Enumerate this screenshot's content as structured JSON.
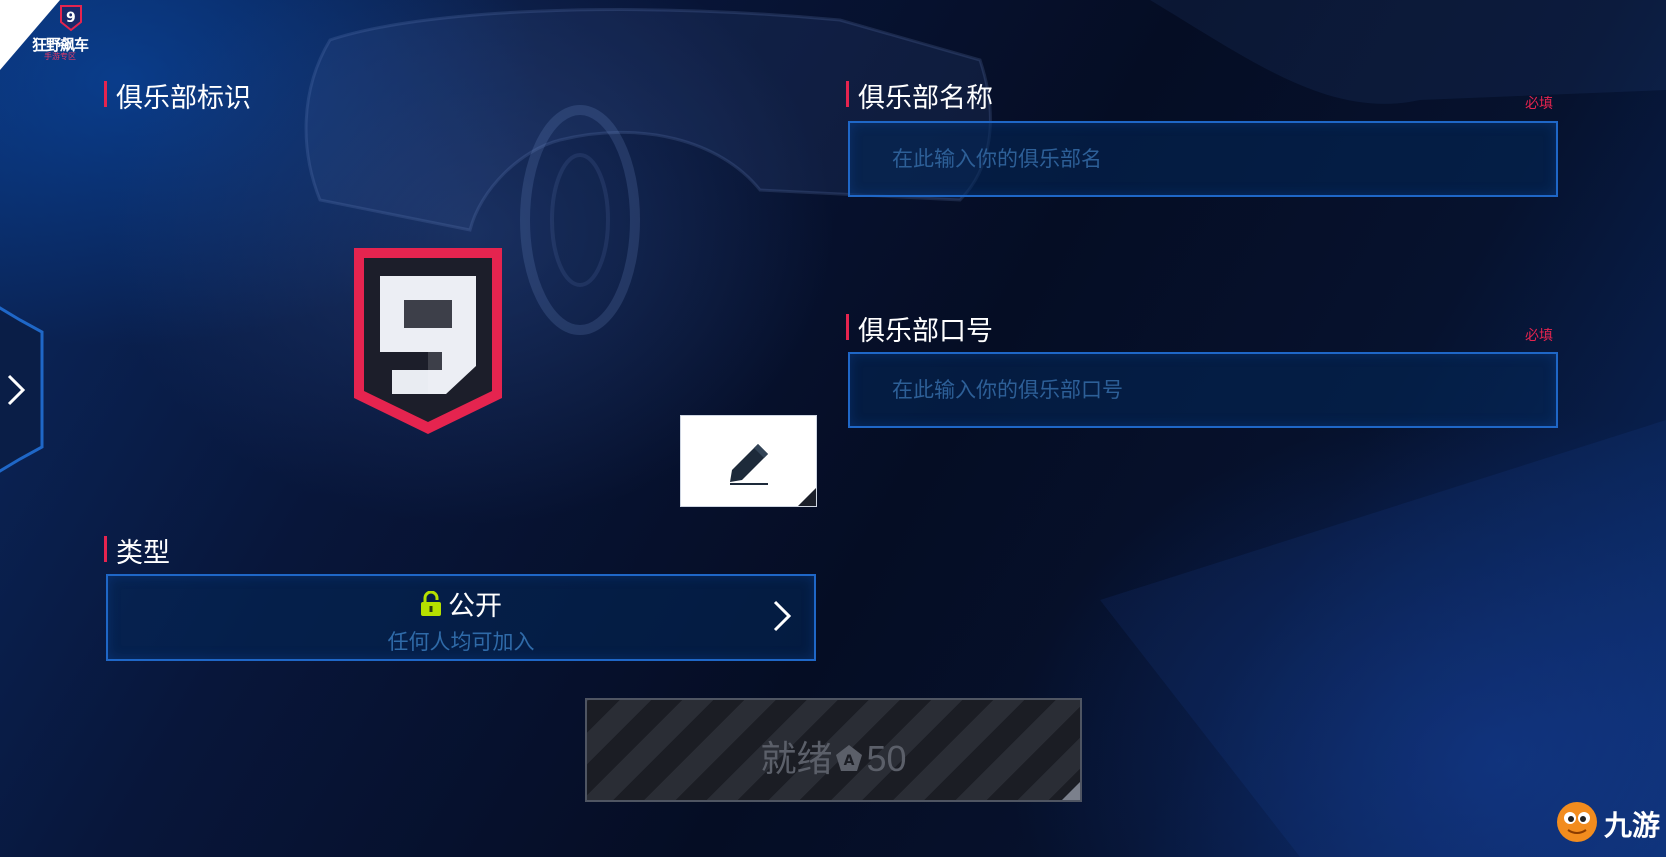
{
  "app": {
    "logo_text": "狂野飙车",
    "logo_sub": "手游专区"
  },
  "club_emblem": {
    "label": "俱乐部标识",
    "emblem_icon": "club-shield-9-icon",
    "edit_icon": "pencil-icon"
  },
  "club_name": {
    "label": "俱乐部名称",
    "required": "必填",
    "placeholder": "在此输入你的俱乐部名",
    "value": ""
  },
  "club_slogan": {
    "label": "俱乐部口号",
    "required": "必填",
    "placeholder": "在此输入你的俱乐部口号",
    "value": ""
  },
  "club_type": {
    "label": "类型",
    "selected": "公开",
    "description": "任何人均可加入",
    "icon": "unlock-icon",
    "lock_color": "#b6e000"
  },
  "ready_button": {
    "label": "就绪",
    "cost": "50",
    "currency_icon": "token-icon"
  },
  "watermark": {
    "text": "九游"
  },
  "colors": {
    "accent_red": "#e5244f",
    "field_border": "#1f67c7"
  }
}
